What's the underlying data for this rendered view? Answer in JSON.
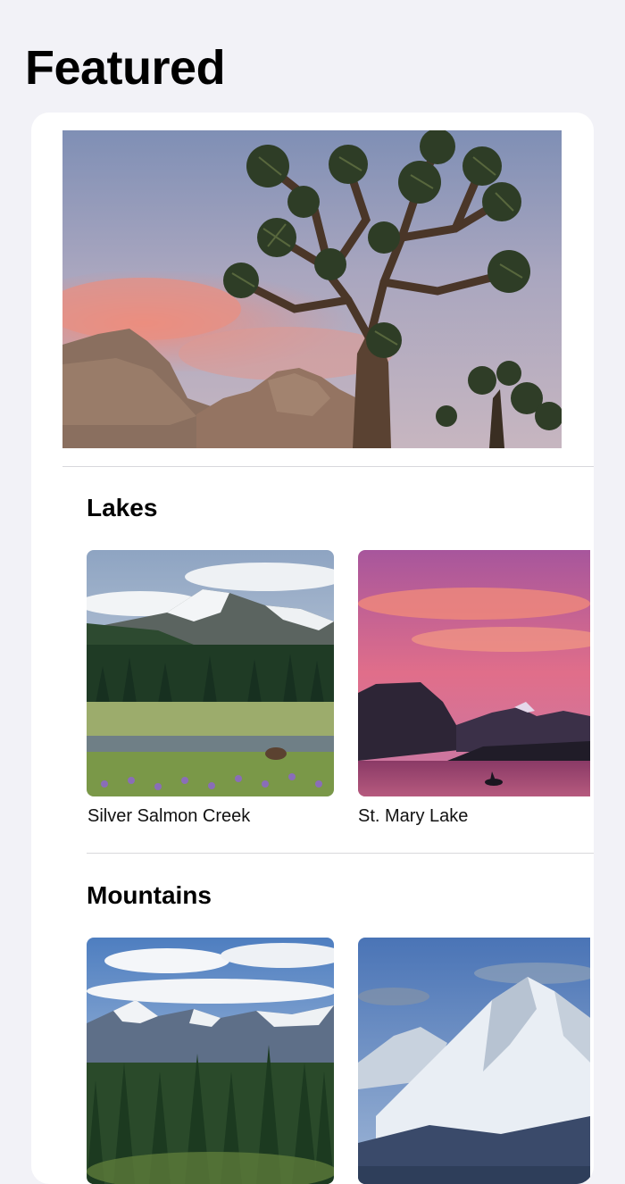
{
  "page": {
    "title": "Featured"
  },
  "hero": {
    "alt": "Joshua tree with desert rocks at sunset"
  },
  "sections": [
    {
      "title": "Lakes",
      "items": [
        {
          "name": "Silver Salmon Creek"
        },
        {
          "name": "St. Mary Lake"
        }
      ]
    },
    {
      "title": "Mountains",
      "items": [
        {
          "name": ""
        },
        {
          "name": ""
        }
      ]
    }
  ],
  "colors": {
    "background": "#f2f2f7",
    "card": "#ffffff",
    "divider": "#d8d8dc"
  }
}
